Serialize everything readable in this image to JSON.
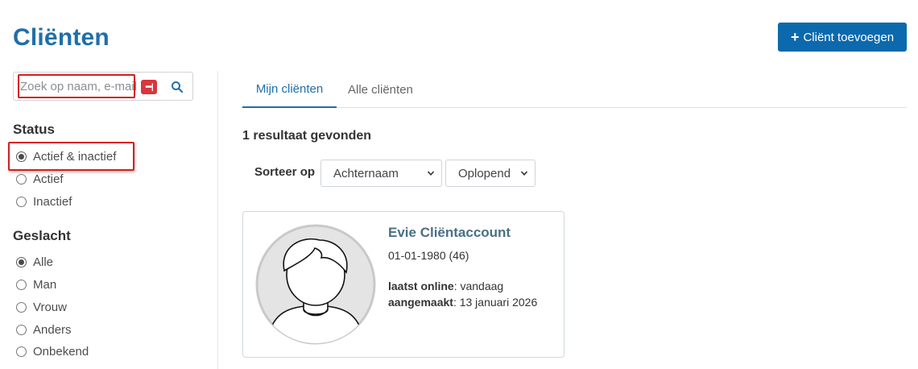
{
  "page": {
    "title": "Cliënten"
  },
  "header": {
    "add_button_label": "Cliënt toevoegen"
  },
  "search": {
    "placeholder": "Zoek op naam, e-mail",
    "value": ""
  },
  "filters": {
    "status": {
      "heading": "Status",
      "options": [
        {
          "label": "Actief & inactief",
          "checked": true
        },
        {
          "label": "Actief",
          "checked": false
        },
        {
          "label": "Inactief",
          "checked": false
        }
      ]
    },
    "gender": {
      "heading": "Geslacht",
      "options": [
        {
          "label": "Alle",
          "checked": true
        },
        {
          "label": "Man",
          "checked": false
        },
        {
          "label": "Vrouw",
          "checked": false
        },
        {
          "label": "Anders",
          "checked": false
        },
        {
          "label": "Onbekend",
          "checked": false
        }
      ]
    }
  },
  "tabs": [
    {
      "label": "Mijn cliënten",
      "active": true
    },
    {
      "label": "Alle cliënten",
      "active": false
    }
  ],
  "results": {
    "text": "1 resultaat gevonden"
  },
  "sort": {
    "label": "Sorteer op",
    "field_value": "Achternaam",
    "order_value": "Oplopend"
  },
  "client": {
    "name": "Evie Cliëntaccount",
    "birthdate": "01-01-1980 (46)",
    "last_online_label": "laatst online",
    "last_online_value": ": vandaag",
    "created_label": "aangemaakt",
    "created_value": ": 13 januari 2026"
  },
  "icons": {
    "search": "search-icon",
    "password_manager": "password-manager-icon",
    "plus": "plus-icon",
    "chevron": "chevron-down-icon",
    "avatar": "avatar-placeholder"
  },
  "colors": {
    "brand_blue": "#1f6fa8",
    "button_blue": "#0c69ad",
    "highlight_red": "#d32020"
  }
}
